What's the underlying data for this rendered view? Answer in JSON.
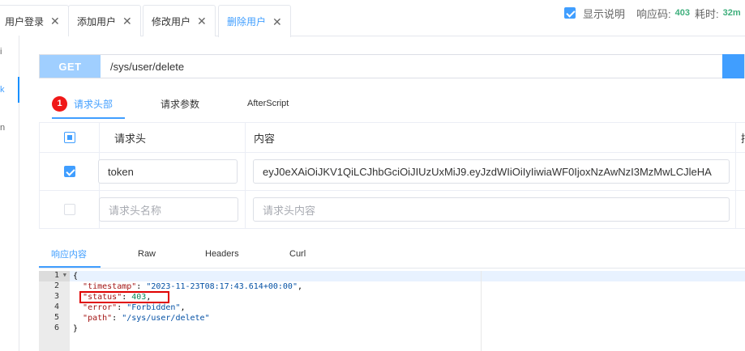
{
  "tabs": [
    {
      "label": "用户登录"
    },
    {
      "label": "添加用户"
    },
    {
      "label": "修改用户"
    },
    {
      "label": "删除用户"
    }
  ],
  "left_marks": [
    "i",
    "k",
    "n"
  ],
  "request": {
    "method": "GET",
    "url": "/sys/user/delete"
  },
  "sub_tabs": {
    "badge": "1",
    "headers_label": "请求头部",
    "params_label": "请求参数",
    "after_label": "AfterScript"
  },
  "header_table": {
    "col_header": "请求头",
    "col_content": "内容",
    "col_extra": "描",
    "row1": {
      "key": "token",
      "value": "eyJ0eXAiOiJKV1QiLCJhbGciOiJIUzUxMiJ9.eyJzdWIiOiIyIiwiaWF0IjoxNzAwNzI3MzMwLCJleHA"
    },
    "row2": {
      "key_placeholder": "请求头名称",
      "value_placeholder": "请求头内容"
    }
  },
  "response": {
    "tabs": [
      "响应内容",
      "Raw",
      "Headers",
      "Curl"
    ],
    "show_desc_label": "显示说明",
    "code_label": "响应码:",
    "code_value": "403",
    "time_label": "耗时:",
    "time_value": "32m"
  },
  "editor": {
    "line_numbers": [
      "1",
      "2",
      "3",
      "4",
      "5",
      "6"
    ],
    "json": {
      "timestamp_key": "\"timestamp\"",
      "timestamp_val": "\"2023-11-23T08:17:43.614+00:00\"",
      "status_key": "\"status\"",
      "status_val": "403",
      "error_key": "\"error\"",
      "error_val": "\"Forbidden\"",
      "path_key": "\"path\"",
      "path_val": "\"/sys/user/delete\""
    }
  }
}
